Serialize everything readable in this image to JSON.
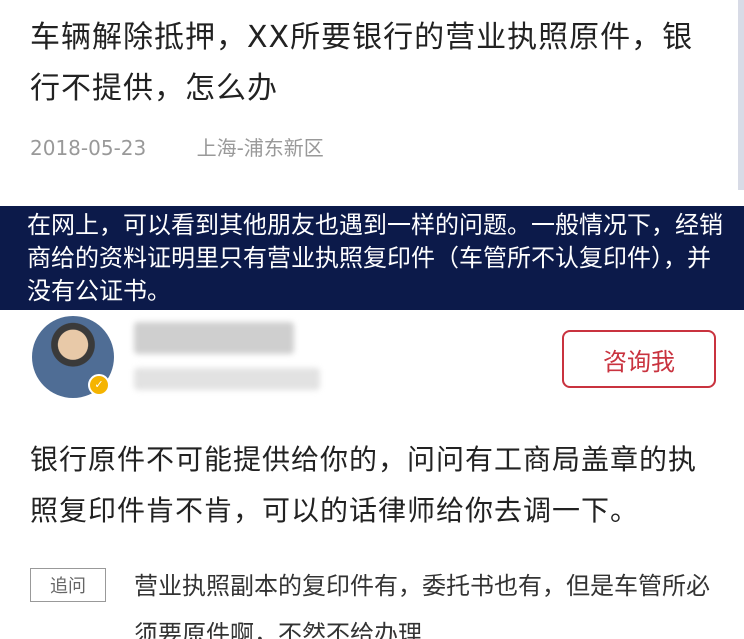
{
  "question": {
    "title": "车辆解除抵押，XX所要银行的营业执照原件，银行不提供，怎么办",
    "date": "2018-05-23",
    "location": "上海-浦东新区"
  },
  "banner": {
    "text": "在网上，可以看到其他朋友也遇到一样的问题。一般情况下，经销商给的资料证明里只有营业执照复印件（车管所不认复印件），并没有公证书。"
  },
  "answer": {
    "consult_label": "咨询我",
    "text": "银行原件不可能提供给你的，问问有工商局盖章的执照复印件肯不肯，可以的话律师给你去调一下。"
  },
  "followup": {
    "tag": "追问",
    "text": "营业执照副本的复印件有，委托书也有，但是车管所必须要原件啊，不然不给办理"
  },
  "colors": {
    "banner_bg": "#0c1a4a",
    "accent_red": "#c9333f",
    "meta_gray": "#999999"
  }
}
